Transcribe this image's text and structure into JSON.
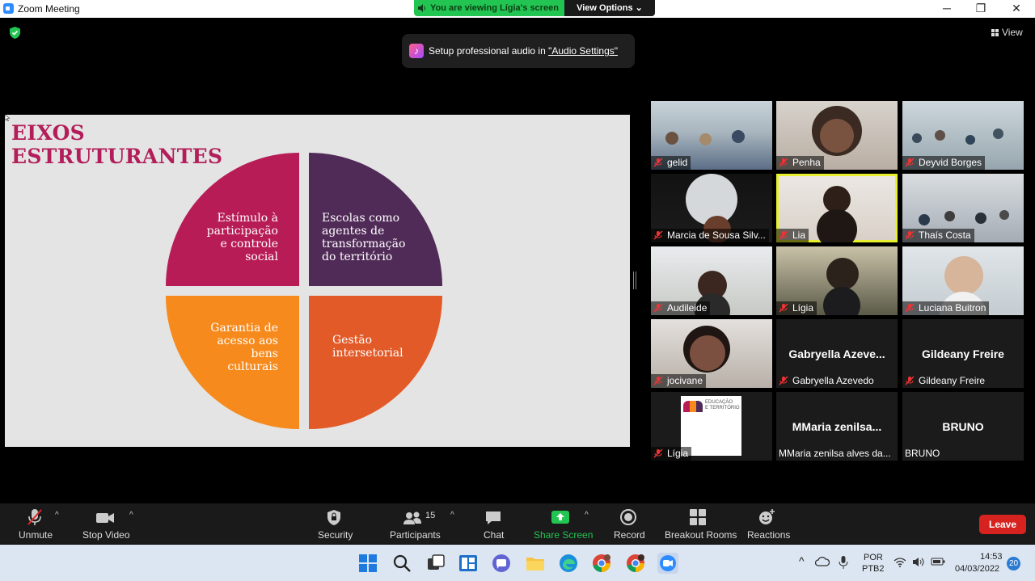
{
  "window": {
    "title": "Zoom Meeting",
    "controls": [
      "─",
      "❐",
      "✕"
    ]
  },
  "banner": {
    "viewing": "You are viewing Lígia's screen",
    "view_options": "View Options"
  },
  "top_right": {
    "view_label": "View"
  },
  "audio_tip": {
    "prefix": "Setup professional audio in ",
    "link": "\"Audio Settings\""
  },
  "slide": {
    "heading_line1": "EIXOS",
    "heading_line2": "ESTRUTURANTES",
    "quadrants": [
      {
        "text": "Estímulo à\nparticipação\ne controle\nsocial",
        "color": "#b81c56"
      },
      {
        "text": "Escolas como\nagentes de\ntransformação\ndo território",
        "color": "#512b58"
      },
      {
        "text": "Garantia de\nacesso aos\nbens\nculturais",
        "color": "#f78a1c"
      },
      {
        "text": "Gestão\nintersetorial",
        "color": "#e25a28"
      }
    ]
  },
  "participants": [
    {
      "name": "gelid",
      "type": "video"
    },
    {
      "name": "Penha",
      "type": "video"
    },
    {
      "name": "Deyvid Borges",
      "type": "video"
    },
    {
      "name": "Marcia de Sousa Silv...",
      "type": "video"
    },
    {
      "name": "Lia",
      "type": "video",
      "active": true
    },
    {
      "name": "Thaís Costa",
      "type": "video"
    },
    {
      "name": "Audileide",
      "type": "video"
    },
    {
      "name": "Lígia",
      "type": "video"
    },
    {
      "name": "Luciana Buitron",
      "type": "video"
    },
    {
      "name": "jocivane",
      "type": "video"
    },
    {
      "name": "Gabryella Azevedo",
      "display": "Gabryella  Azeve...",
      "type": "name"
    },
    {
      "name": "Gildeany Freire",
      "display": "Gildeany Freire",
      "type": "name"
    },
    {
      "name": "Lígia",
      "type": "logo",
      "logo_text": "EDUCAÇÃO\nE TERRITÓRIO"
    },
    {
      "name": "MMaria zenilsa alves da...",
      "display": "MMaria  zenilsa...",
      "type": "name",
      "muted_icon": false
    },
    {
      "name": "BRUNO",
      "display": "BRUNO",
      "type": "name",
      "muted_icon": false
    }
  ],
  "toolbar": {
    "unmute": "Unmute",
    "stop_video": "Stop Video",
    "security": "Security",
    "participants": "Participants",
    "participants_count": "15",
    "chat": "Chat",
    "share_screen": "Share Screen",
    "record": "Record",
    "breakout": "Breakout Rooms",
    "reactions": "Reactions",
    "leave": "Leave"
  },
  "taskbar": {
    "lang1": "POR",
    "lang2": "PTB2",
    "time": "14:53",
    "date": "04/03/2022",
    "notifications": "20",
    "chevron": "^"
  },
  "colors": {
    "accent_green": "#23c552",
    "leave_red": "#d6231f",
    "active_yellow": "#e8f02e"
  }
}
